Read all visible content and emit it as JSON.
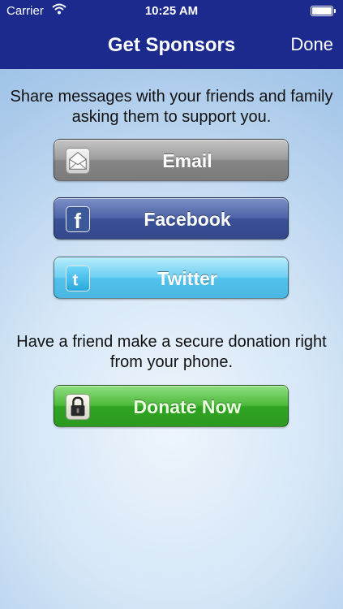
{
  "status_bar": {
    "carrier": "Carrier",
    "time": "10:25 AM",
    "wifi_icon": "wifi-icon",
    "battery_level": 1.0
  },
  "nav": {
    "title": "Get Sponsors",
    "done_label": "Done"
  },
  "share": {
    "message": "Share messages with your friends and family asking them to support you.",
    "buttons": [
      {
        "label": "Email",
        "icon": "envelope-icon"
      },
      {
        "label": "Facebook",
        "icon": "facebook-icon"
      },
      {
        "label": "Twitter",
        "icon": "twitter-icon"
      }
    ]
  },
  "donate": {
    "message": "Have a friend make a secure donation right from your phone.",
    "button_label": "Donate Now",
    "icon": "lock-icon"
  },
  "colors": {
    "nav_background": "#1b2a8c",
    "email_button": "#9c9c9c",
    "facebook_button": "#3a5196",
    "twitter_button": "#52c2ec",
    "donate_button": "#2fa423"
  }
}
